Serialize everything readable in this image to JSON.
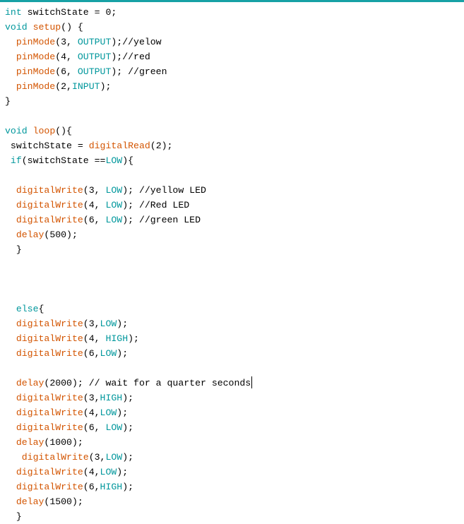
{
  "accent_color": "#17a1a5",
  "colors": {
    "keyword": "#00979c",
    "function": "#d35400",
    "constant": "#00979c",
    "text": "#000000"
  },
  "code_lines": [
    [
      [
        "kw",
        "int"
      ],
      [
        "plain",
        " switchState = 0;"
      ]
    ],
    [
      [
        "kw",
        "void"
      ],
      [
        "plain",
        " "
      ],
      [
        "fn",
        "setup"
      ],
      [
        "plain",
        "() {"
      ]
    ],
    [
      [
        "plain",
        "  "
      ],
      [
        "fn",
        "pinMode"
      ],
      [
        "plain",
        "(3, "
      ],
      [
        "cst",
        "OUTPUT"
      ],
      [
        "plain",
        ");//yelow"
      ]
    ],
    [
      [
        "plain",
        "  "
      ],
      [
        "fn",
        "pinMode"
      ],
      [
        "plain",
        "(4, "
      ],
      [
        "cst",
        "OUTPUT"
      ],
      [
        "plain",
        ");//red"
      ]
    ],
    [
      [
        "plain",
        "  "
      ],
      [
        "fn",
        "pinMode"
      ],
      [
        "plain",
        "(6, "
      ],
      [
        "cst",
        "OUTPUT"
      ],
      [
        "plain",
        "); //green"
      ]
    ],
    [
      [
        "plain",
        "  "
      ],
      [
        "fn",
        "pinMode"
      ],
      [
        "plain",
        "(2,"
      ],
      [
        "cst",
        "INPUT"
      ],
      [
        "plain",
        ");"
      ]
    ],
    [
      [
        "plain",
        "}"
      ]
    ],
    [
      [
        "plain",
        ""
      ]
    ],
    [
      [
        "kw",
        "void"
      ],
      [
        "plain",
        " "
      ],
      [
        "fn",
        "loop"
      ],
      [
        "plain",
        "(){"
      ]
    ],
    [
      [
        "plain",
        " switchState = "
      ],
      [
        "fn",
        "digitalRead"
      ],
      [
        "plain",
        "(2);"
      ]
    ],
    [
      [
        "plain",
        " "
      ],
      [
        "kw",
        "if"
      ],
      [
        "plain",
        "(switchState =="
      ],
      [
        "cst",
        "LOW"
      ],
      [
        "plain",
        "){"
      ]
    ],
    [
      [
        "plain",
        ""
      ]
    ],
    [
      [
        "plain",
        "  "
      ],
      [
        "fn",
        "digitalWrite"
      ],
      [
        "plain",
        "(3, "
      ],
      [
        "cst",
        "LOW"
      ],
      [
        "plain",
        "); //yellow LED"
      ]
    ],
    [
      [
        "plain",
        "  "
      ],
      [
        "fn",
        "digitalWrite"
      ],
      [
        "plain",
        "(4, "
      ],
      [
        "cst",
        "LOW"
      ],
      [
        "plain",
        "); //Red LED"
      ]
    ],
    [
      [
        "plain",
        "  "
      ],
      [
        "fn",
        "digitalWrite"
      ],
      [
        "plain",
        "(6, "
      ],
      [
        "cst",
        "LOW"
      ],
      [
        "plain",
        "); //green LED"
      ]
    ],
    [
      [
        "plain",
        "  "
      ],
      [
        "fn",
        "delay"
      ],
      [
        "plain",
        "(500);"
      ]
    ],
    [
      [
        "plain",
        "  }"
      ]
    ],
    [
      [
        "plain",
        ""
      ]
    ],
    [
      [
        "plain",
        ""
      ]
    ],
    [
      [
        "plain",
        ""
      ]
    ],
    [
      [
        "plain",
        "  "
      ],
      [
        "kw",
        "else"
      ],
      [
        "plain",
        "{"
      ]
    ],
    [
      [
        "plain",
        "  "
      ],
      [
        "fn",
        "digitalWrite"
      ],
      [
        "plain",
        "(3,"
      ],
      [
        "cst",
        "LOW"
      ],
      [
        "plain",
        ");"
      ]
    ],
    [
      [
        "plain",
        "  "
      ],
      [
        "fn",
        "digitalWrite"
      ],
      [
        "plain",
        "(4, "
      ],
      [
        "cst",
        "HIGH"
      ],
      [
        "plain",
        ");"
      ]
    ],
    [
      [
        "plain",
        "  "
      ],
      [
        "fn",
        "digitalWrite"
      ],
      [
        "plain",
        "(6,"
      ],
      [
        "cst",
        "LOW"
      ],
      [
        "plain",
        ");"
      ]
    ],
    [
      [
        "plain",
        ""
      ]
    ],
    [
      [
        "plain",
        "  "
      ],
      [
        "fn",
        "delay"
      ],
      [
        "plain",
        "(2000); // wait for a quarter seconds"
      ]
    ],
    [
      [
        "plain",
        "  "
      ],
      [
        "fn",
        "digitalWrite"
      ],
      [
        "plain",
        "(3,"
      ],
      [
        "cst",
        "HIGH"
      ],
      [
        "plain",
        ");"
      ]
    ],
    [
      [
        "plain",
        "  "
      ],
      [
        "fn",
        "digitalWrite"
      ],
      [
        "plain",
        "(4,"
      ],
      [
        "cst",
        "LOW"
      ],
      [
        "plain",
        ");"
      ]
    ],
    [
      [
        "plain",
        "  "
      ],
      [
        "fn",
        "digitalWrite"
      ],
      [
        "plain",
        "(6, "
      ],
      [
        "cst",
        "LOW"
      ],
      [
        "plain",
        ");"
      ]
    ],
    [
      [
        "plain",
        "  "
      ],
      [
        "fn",
        "delay"
      ],
      [
        "plain",
        "(1000);"
      ]
    ],
    [
      [
        "plain",
        "   "
      ],
      [
        "fn",
        "digitalWrite"
      ],
      [
        "plain",
        "(3,"
      ],
      [
        "cst",
        "LOW"
      ],
      [
        "plain",
        ");"
      ]
    ],
    [
      [
        "plain",
        "  "
      ],
      [
        "fn",
        "digitalWrite"
      ],
      [
        "plain",
        "(4,"
      ],
      [
        "cst",
        "LOW"
      ],
      [
        "plain",
        ");"
      ]
    ],
    [
      [
        "plain",
        "  "
      ],
      [
        "fn",
        "digitalWrite"
      ],
      [
        "plain",
        "(6,"
      ],
      [
        "cst",
        "HIGH"
      ],
      [
        "plain",
        ");"
      ]
    ],
    [
      [
        "plain",
        "  "
      ],
      [
        "fn",
        "delay"
      ],
      [
        "plain",
        "(1500);"
      ]
    ],
    [
      [
        "plain",
        "  }"
      ]
    ]
  ],
  "cursor_line_number": 26
}
